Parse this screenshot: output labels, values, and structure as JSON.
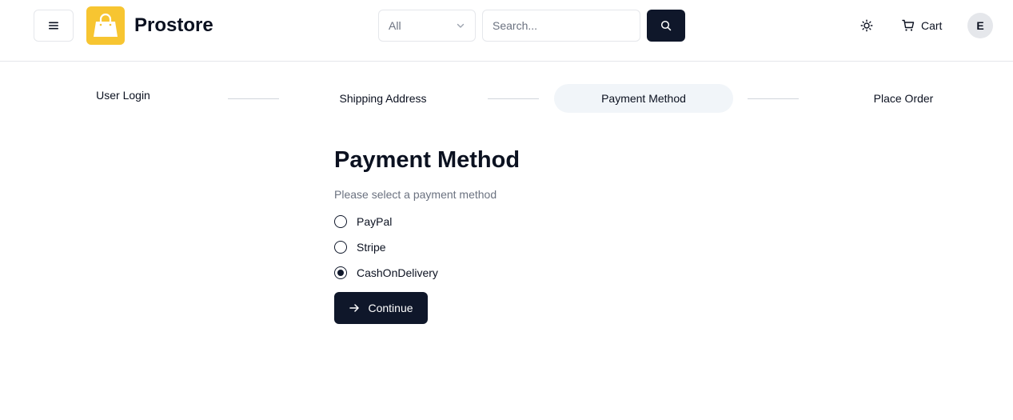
{
  "header": {
    "brand": "Prostore",
    "category_select": {
      "value": "All"
    },
    "search": {
      "placeholder": "Search..."
    },
    "cart_label": "Cart",
    "avatar_initial": "E"
  },
  "steps": [
    {
      "label": "User Login",
      "active": false
    },
    {
      "label": "Shipping Address",
      "active": false
    },
    {
      "label": "Payment Method",
      "active": true
    },
    {
      "label": "Place Order",
      "active": false
    }
  ],
  "payment": {
    "title": "Payment Method",
    "subtitle": "Please select a payment method",
    "options": [
      {
        "label": "PayPal",
        "selected": false
      },
      {
        "label": "Stripe",
        "selected": false
      },
      {
        "label": "CashOnDelivery",
        "selected": true
      }
    ],
    "continue_label": "Continue"
  },
  "colors": {
    "brand_yellow": "#f7c531",
    "primary_dark": "#0f172a",
    "muted_text": "#6b7280",
    "active_step_bg": "#f1f5f9"
  },
  "icons": {
    "menu": "menu-icon",
    "logo": "shopping-bag-icon",
    "chevron": "chevron-down-icon",
    "search": "search-icon",
    "theme": "sun-icon",
    "cart": "shopping-cart-icon",
    "continue": "arrow-right-icon"
  }
}
